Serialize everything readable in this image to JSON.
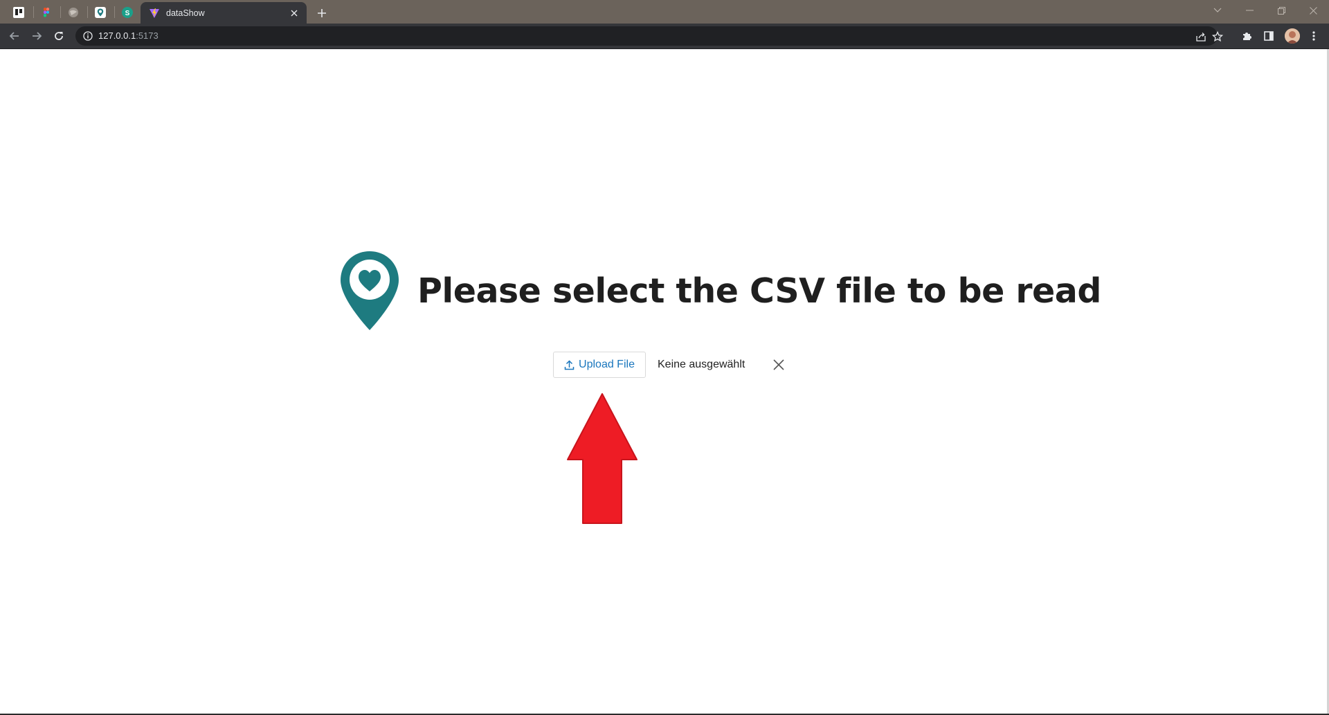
{
  "browser": {
    "pinned_tabs": [
      {
        "name": "trello-tab-icon"
      },
      {
        "name": "figma-tab-icon"
      },
      {
        "name": "globe-tab-icon"
      },
      {
        "name": "shield-tab-icon"
      },
      {
        "name": "s-app-tab-icon",
        "letter": "S"
      }
    ],
    "active_tab": {
      "title": "dataShow"
    },
    "address": {
      "host": "127.0.0.1",
      "port": ":5173"
    }
  },
  "page": {
    "title": "Please select the CSV file to be read",
    "upload": {
      "button_label": "Upload File",
      "status": "Keine ausgewählt"
    }
  },
  "colors": {
    "brand_teal": "#1e7b80",
    "upload_blue": "#1976bd",
    "annotation_red": "#ee1c25"
  }
}
